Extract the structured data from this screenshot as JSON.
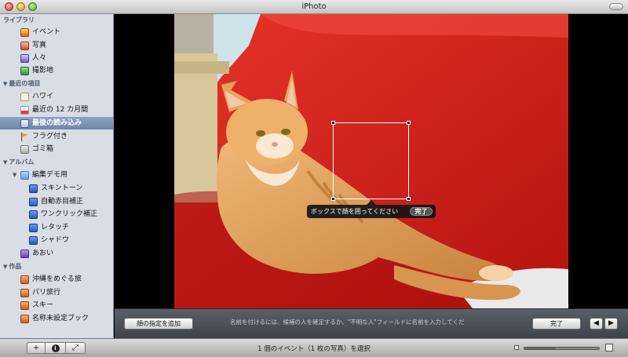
{
  "window": {
    "title": "iPhoto"
  },
  "sidebar": {
    "library_header": "ライブラリ",
    "library": [
      {
        "label": "イベント",
        "icon": "events-icon"
      },
      {
        "label": "写真",
        "icon": "photos-icon"
      },
      {
        "label": "人々",
        "icon": "people-icon"
      },
      {
        "label": "撮影地",
        "icon": "places-icon"
      }
    ],
    "recent_header": "最近の項目",
    "recent": [
      {
        "label": "ハワイ",
        "icon": "event-icon"
      },
      {
        "label": "最近の 12 カ月間",
        "icon": "calendar-icon"
      },
      {
        "label": "最後の読み込み",
        "icon": "import-icon",
        "selected": true
      },
      {
        "label": "フラグ付き",
        "icon": "flag-icon"
      },
      {
        "label": "ゴミ箱",
        "icon": "trash-icon"
      }
    ],
    "albums_header": "アルバム",
    "album_folder": "編集デモ用",
    "album_folder_items": [
      "スキントーン",
      "自動赤目補正",
      "ワンクリック補正",
      "レタッチ",
      "シャドウ"
    ],
    "smart_album": "あおい",
    "projects_header": "作品",
    "projects": [
      "沖縄をめぐる旅",
      "パリ旅行",
      "スキー",
      "名称未設定ブック"
    ]
  },
  "viewer": {
    "hint_text": "ボックスで顔を囲ってください",
    "hint_done": "完了"
  },
  "facebar": {
    "add_face_label": "顔の指定を追加",
    "message": "名前を付けるには、候補の人を確定するか、\"不明な人\"フィールドに名前を入力してくださ",
    "done_label": "完了",
    "prev_label": "◀",
    "next_label": "▶"
  },
  "bottombar": {
    "add_label": "+",
    "info_label": "i",
    "fullscreen_label": "⤢",
    "status": "1 個のイベント（1 枚の写真）を選択",
    "zoom_level": 0.42
  }
}
